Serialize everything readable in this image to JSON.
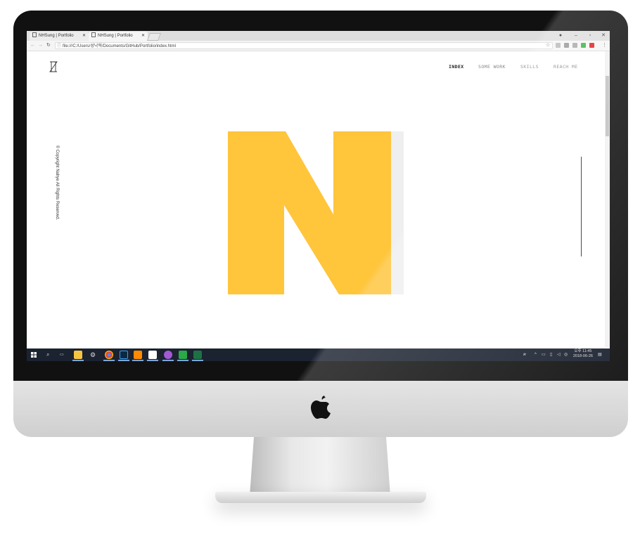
{
  "browser": {
    "tabs": [
      {
        "title": "NHSung | Portfolio",
        "active": false
      },
      {
        "title": "NHSung | Portfolio",
        "active": true
      }
    ],
    "url": "file:///C:/Users/성낙혁/Documents/GitHub/Portfolio/index.html"
  },
  "site": {
    "nav": [
      "INDEX",
      "SOME WORK",
      "SKILLS",
      "REACH ME"
    ],
    "active_nav": "INDEX",
    "copyright": "© Copyright Nahye All Rights Reserved.",
    "hero_letter": "N",
    "accent_color": "#ffc53b",
    "shadow_color": "#efefef"
  },
  "taskbar": {
    "clock_top": "오후 11:45",
    "clock_bottom": "2018-06-26",
    "apps": [
      "start-icon",
      "search-icon",
      "task-view-icon",
      "file-explorer-icon",
      "settings-icon",
      "chrome-icon",
      "photoshop-icon",
      "sublime-icon",
      "app-icon",
      "media-icon",
      "app-icon",
      "excel-icon"
    ]
  }
}
